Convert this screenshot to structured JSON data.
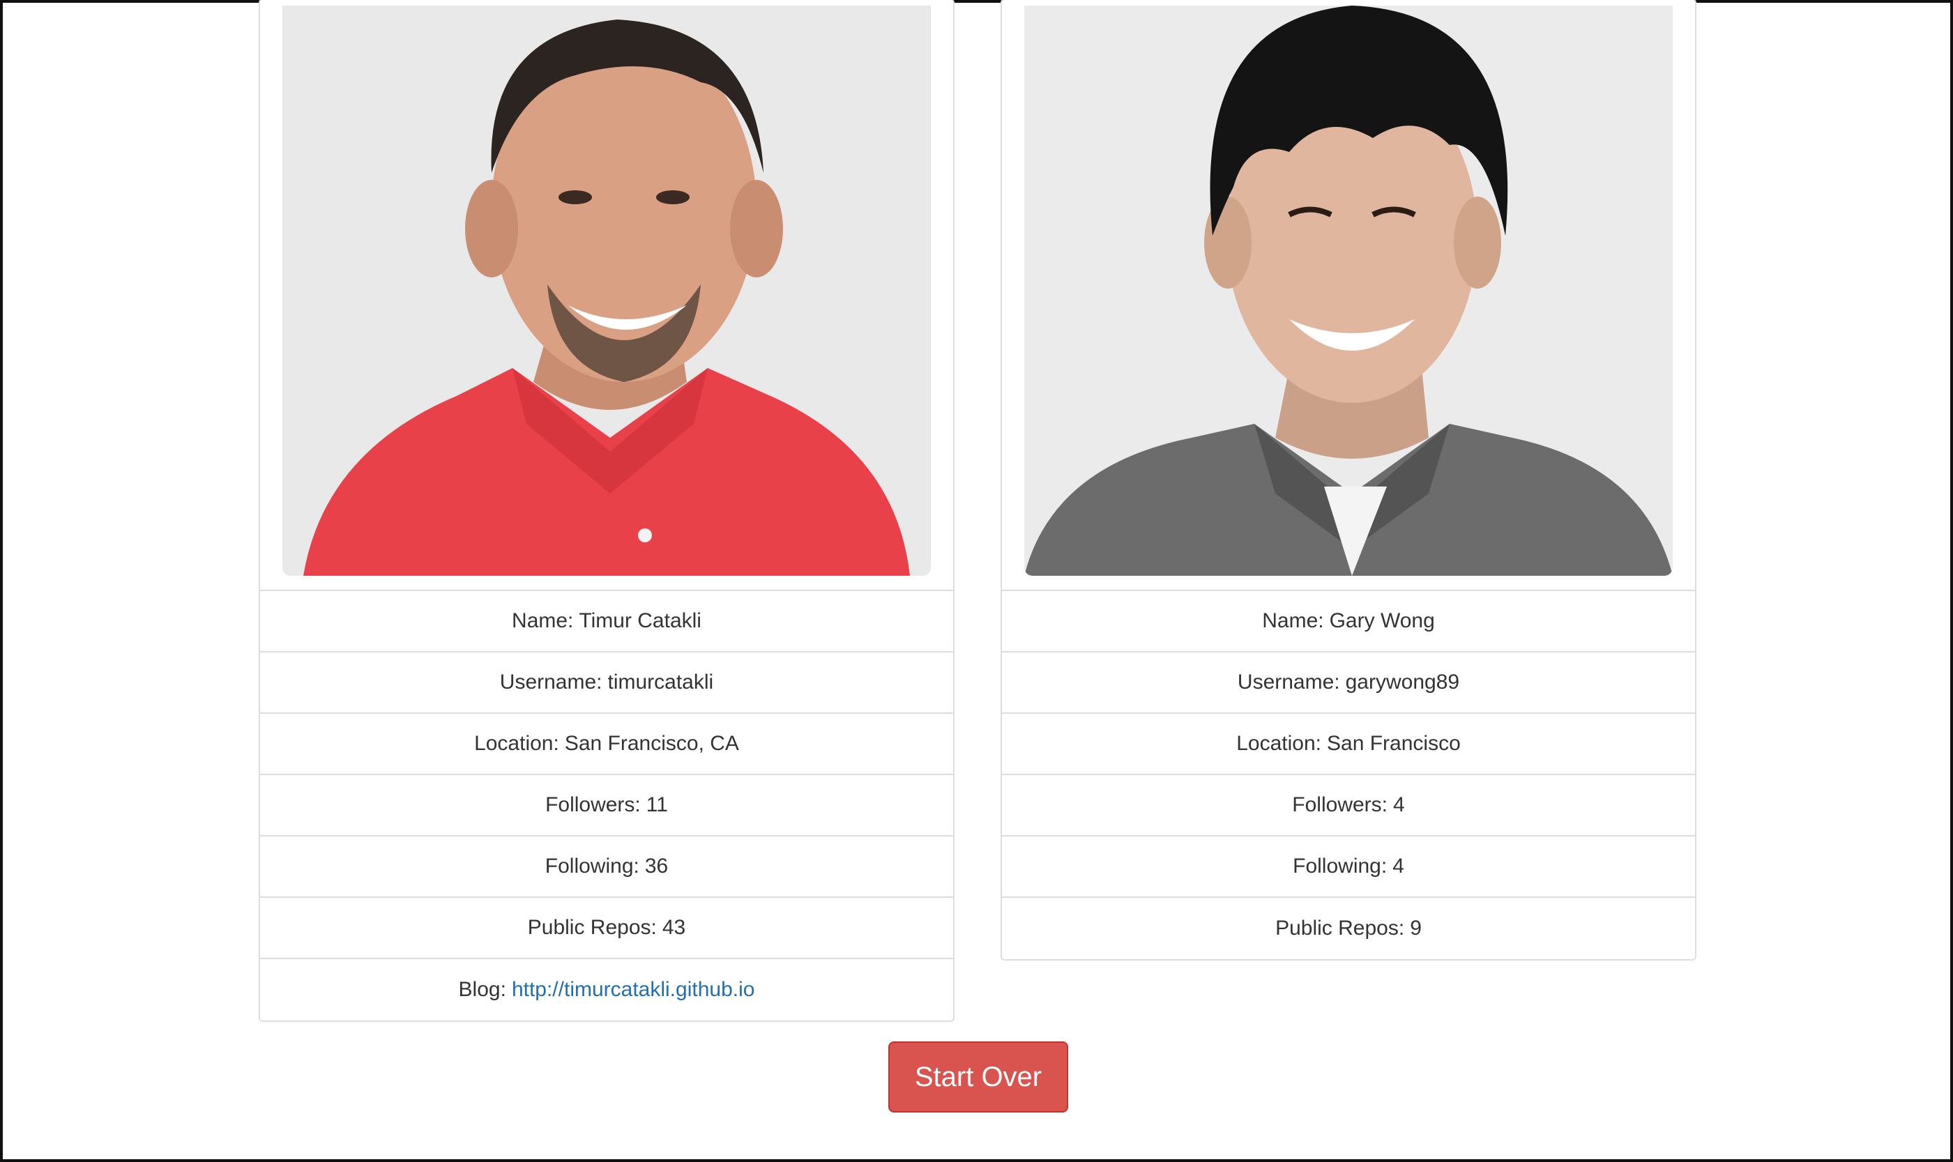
{
  "profiles": [
    {
      "photo_alt": "Timur Catakli",
      "name_label": "Name:",
      "name": "Timur Catakli",
      "username_label": "Username:",
      "username": "timurcatakli",
      "location_label": "Location:",
      "location": "San Francisco, CA",
      "followers_label": "Followers:",
      "followers": "11",
      "following_label": "Following:",
      "following": "36",
      "repos_label": "Public Repos:",
      "repos": "43",
      "blog_label": "Blog:",
      "blog": "http://timurcatakli.github.io"
    },
    {
      "photo_alt": "Gary Wong",
      "name_label": "Name:",
      "name": "Gary Wong",
      "username_label": "Username:",
      "username": "garywong89",
      "location_label": "Location:",
      "location": "San Francisco",
      "followers_label": "Followers:",
      "followers": "4",
      "following_label": "Following:",
      "following": "4",
      "repos_label": "Public Repos:",
      "repos": "9"
    }
  ],
  "actions": {
    "start_over_label": "Start Over"
  },
  "colors": {
    "button_bg": "#d9534f",
    "link": "#1f6fb2",
    "border": "#dddddd"
  }
}
